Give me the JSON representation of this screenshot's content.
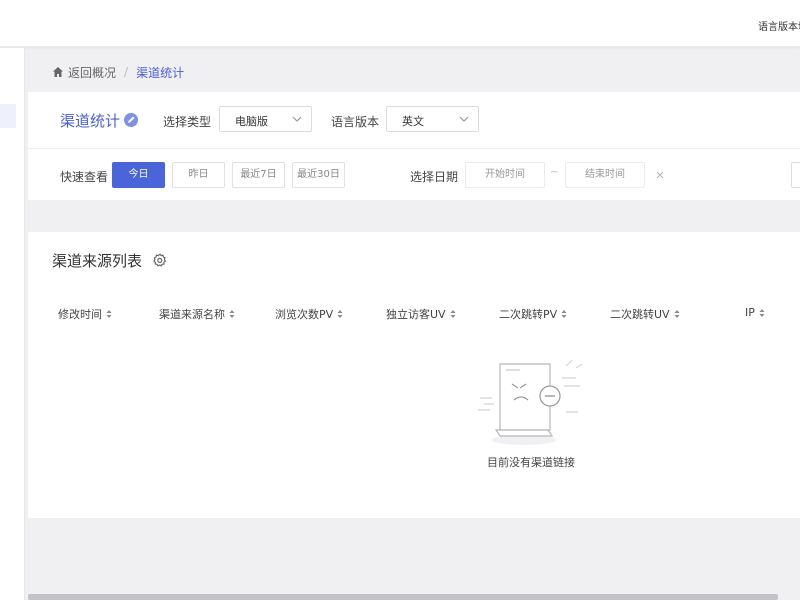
{
  "header": {
    "language_version": "语言版本切"
  },
  "breadcrumb": {
    "back": "返回概况",
    "separator": "/",
    "current": "渠道统计"
  },
  "filters": {
    "page_title": "渠道统计",
    "type_label": "选择类型",
    "type_value": "电脑版",
    "lang_label": "语言版本",
    "lang_value": "英文",
    "quick_label": "快速查看",
    "quick_buttons": [
      {
        "label": "今日",
        "active": true
      },
      {
        "label": "昨日",
        "active": false
      },
      {
        "label": "最近7日",
        "active": false
      },
      {
        "label": "最近30日",
        "active": false
      }
    ],
    "date_label": "选择日期",
    "start_placeholder": "开始时间",
    "range_separator": "~",
    "end_placeholder": "结束时间"
  },
  "table": {
    "title": "渠道来源列表",
    "columns": [
      "修改时间",
      "渠道来源名称",
      "浏览次数PV",
      "独立访客UV",
      "二次跳转PV",
      "二次跳转UV",
      "IP"
    ],
    "empty_text": "目前没有渠道链接"
  },
  "colors": {
    "accent": "#4a64d9",
    "title_blue": "#4a5fd6",
    "background": "#f0f0f3"
  }
}
